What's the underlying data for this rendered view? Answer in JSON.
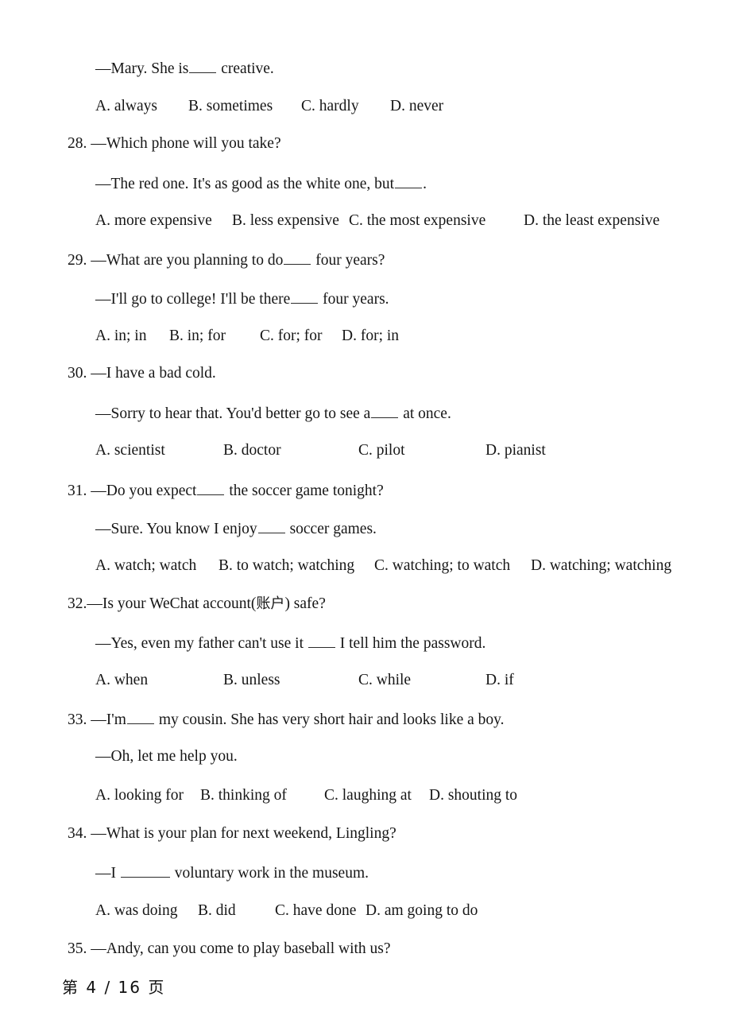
{
  "document": {
    "type": "exam-paper",
    "language": "English test with Chinese annotations",
    "footer": "第 4 / 16 页",
    "footer_page_current": "4",
    "footer_page_total": "16"
  },
  "questions": [
    {
      "number": "",
      "stem": "",
      "reply": "—Mary. She is____ creative.",
      "reply_prefix": "—Mary. She is",
      "reply_suffix": " creative.",
      "blank_style": "b4",
      "options": [
        {
          "label": "A. always"
        },
        {
          "label": "B. sometimes"
        },
        {
          "label": "C. hardly"
        },
        {
          "label": "D. never"
        }
      ],
      "option_offsets": [
        0,
        117,
        259,
        371
      ]
    },
    {
      "number": "28.",
      "stem": "28. —Which phone will you take?",
      "stem_text": "—Which phone will you take?",
      "reply_prefix": "—The red one. It's as good as the white one, but",
      "reply_suffix": ".",
      "blank_style": "b4",
      "options": [
        {
          "label": "A. more expensive"
        },
        {
          "label": "B. less expensive"
        },
        {
          "label": "C. the most expensive"
        },
        {
          "label": "D. the least expensive"
        }
      ],
      "option_offsets": [
        0,
        172,
        319,
        539
      ]
    },
    {
      "number": "29.",
      "stem_text": "—What are you planning to do",
      "stem_suffix": " four years?",
      "stem_blank_style": "b4",
      "reply_prefix": "—I'll go to college! I'll be there",
      "reply_suffix": " four years.",
      "blank_style": "b4",
      "options": [
        {
          "label": "A. in; in"
        },
        {
          "label": "B. in; for"
        },
        {
          "label": "C. for; for"
        },
        {
          "label": "D. for; in"
        }
      ],
      "option_offsets": [
        0,
        93,
        207,
        310
      ]
    },
    {
      "number": "30.",
      "stem_text": "—I have a bad cold.",
      "reply_prefix": "—Sorry to hear that. You'd better go to see a",
      "reply_suffix": " at once.",
      "blank_style": "b4",
      "options": [
        {
          "label": "A. scientist"
        },
        {
          "label": "B. doctor"
        },
        {
          "label": "C. pilot"
        },
        {
          "label": "D. pianist"
        }
      ],
      "option_offsets": [
        0,
        161,
        331,
        491
      ]
    },
    {
      "number": "31.",
      "stem_text": "—Do you expect",
      "stem_suffix": " the soccer game tonight?",
      "stem_blank_style": "b4",
      "reply_prefix": "—Sure. You know I enjoy",
      "reply_suffix": " soccer games.",
      "blank_style": "b4",
      "options": [
        {
          "label": "A. watch; watch"
        },
        {
          "label": "B. to watch; watching"
        },
        {
          "label": "C. watching; to watch"
        },
        {
          "label": "D. watching; watching"
        }
      ],
      "option_offsets": [
        0,
        155,
        351,
        548
      ]
    },
    {
      "number": "32.",
      "stem_text_pre": "—Is your WeChat account(",
      "stem_cjk": "账户",
      "stem_text_post": ") safe?",
      "reply_prefix": "—Yes, even my father can't use it ",
      "reply_suffix": " I tell him the password.",
      "blank_style": "b4",
      "options": [
        {
          "label": "A. when"
        },
        {
          "label": "B. unless"
        },
        {
          "label": "C. while"
        },
        {
          "label": "D. if"
        }
      ],
      "option_offsets": [
        0,
        161,
        331,
        491
      ]
    },
    {
      "number": "33.",
      "stem_text": "—I'm",
      "stem_suffix": " my cousin. She has very short hair and looks like a boy.",
      "stem_blank_style": "b4",
      "reply_prefix": "—Oh, let me help you.",
      "reply_suffix": "",
      "options": [
        {
          "label": "A. looking for"
        },
        {
          "label": "B. thinking of"
        },
        {
          "label": "C. laughing at"
        },
        {
          "label": "D. shouting to"
        }
      ],
      "option_offsets": [
        0,
        132,
        288,
        420
      ]
    },
    {
      "number": "34.",
      "stem_text": "—What is your plan for next weekend, Lingling?",
      "reply_prefix": "—I ",
      "reply_suffix": " voluntary work in the museum.",
      "blank_style": "b8",
      "options": [
        {
          "label": "A. was doing"
        },
        {
          "label": "B. did"
        },
        {
          "label": "C. have done"
        },
        {
          "label": "D. am going to do"
        }
      ],
      "option_offsets": [
        0,
        129,
        226,
        340
      ]
    },
    {
      "number": "35.",
      "stem_text": "—Andy, can you come to play baseball with us?",
      "reply_prefix": "",
      "reply_suffix": "",
      "options": [],
      "option_offsets": []
    }
  ],
  "lines": {
    "l1_reply_pre": "—Mary. She is",
    "l1_reply_post": " creative.",
    "q28_stem_num": "28.",
    "q28_stem": " —Which phone will you take?",
    "q28_reply_pre": "—The red one. It's as good as the white one, but",
    "q28_reply_post": ".",
    "q29_stem_num": "29.",
    "q29_stem_pre": " —What are you planning to do",
    "q29_stem_post": " four years?",
    "q29_reply_pre": "—I'll go to college! I'll be there",
    "q29_reply_post": " four years.",
    "q30_stem_num": "30.",
    "q30_stem": " —I have a bad cold.",
    "q30_reply_pre": "—Sorry to hear that. You'd better go to see a",
    "q30_reply_post": " at once.",
    "q31_stem_num": "31.",
    "q31_stem_pre": " —Do you expect",
    "q31_stem_post": " the soccer game tonight?",
    "q31_reply_pre": "—Sure. You know I enjoy",
    "q31_reply_post": " soccer games.",
    "q32_stem_num": "32.",
    "q32_stem_pre": "—Is your WeChat account(",
    "q32_stem_cjk": "账户",
    "q32_stem_post": ") safe?",
    "q32_reply_pre": "—Yes, even my father can't use it ",
    "q32_reply_post": " I tell him the password.",
    "q33_stem_num": "33.",
    "q33_stem_pre": " —I'm",
    "q33_stem_post": " my cousin. She has very short hair and looks like a boy.",
    "q33_reply": "—Oh, let me help you.",
    "q34_stem_num": "34.",
    "q34_stem": " —What is your plan for next weekend, Lingling?",
    "q34_reply_pre": "—I ",
    "q34_reply_post": " voluntary work in the museum.",
    "q35_stem_num": "35.",
    "q35_stem": " —Andy, can you come to play baseball with us?"
  },
  "options": {
    "q27": [
      "A. always",
      "B. sometimes",
      "C. hardly",
      "D. never"
    ],
    "q28": [
      "A. more expensive",
      "B. less expensive",
      "C. the most expensive",
      "D. the least expensive"
    ],
    "q29": [
      "A. in; in",
      "B. in; for",
      "C. for; for",
      "D. for; in"
    ],
    "q30": [
      "A. scientist",
      "B. doctor",
      "C. pilot",
      "D. pianist"
    ],
    "q31": [
      "A. watch; watch",
      "B. to watch; watching",
      "C. watching; to watch",
      "D. watching; watching"
    ],
    "q32": [
      "A. when",
      "B. unless",
      "C. while",
      "D. if"
    ],
    "q33": [
      "A. looking for",
      "B. thinking of",
      "C. laughing at",
      "D. shouting to"
    ],
    "q34": [
      "A. was doing",
      "B. did",
      "C. have done",
      "D. am going to do"
    ]
  }
}
